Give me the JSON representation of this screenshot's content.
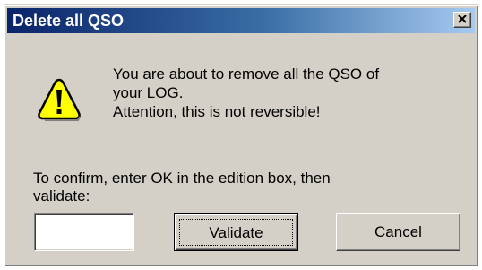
{
  "window": {
    "title": "Delete all QSO"
  },
  "message": {
    "lines": [
      "You are about to remove all the QSO of",
      "your LOG.",
      "Attention, this is not reversible!"
    ]
  },
  "confirm": {
    "lines": [
      "To confirm, enter OK in the edition box, then",
      "validate:"
    ],
    "input_value": ""
  },
  "buttons": {
    "validate": "Validate",
    "cancel": "Cancel"
  },
  "icons": {
    "warning": "warning-icon",
    "close": "close-icon"
  },
  "colors": {
    "title_bar_start": "#0a246a",
    "title_bar_end": "#a6caf0",
    "dialog_face": "#d4d0c8",
    "warning_fill": "#ffff00"
  }
}
